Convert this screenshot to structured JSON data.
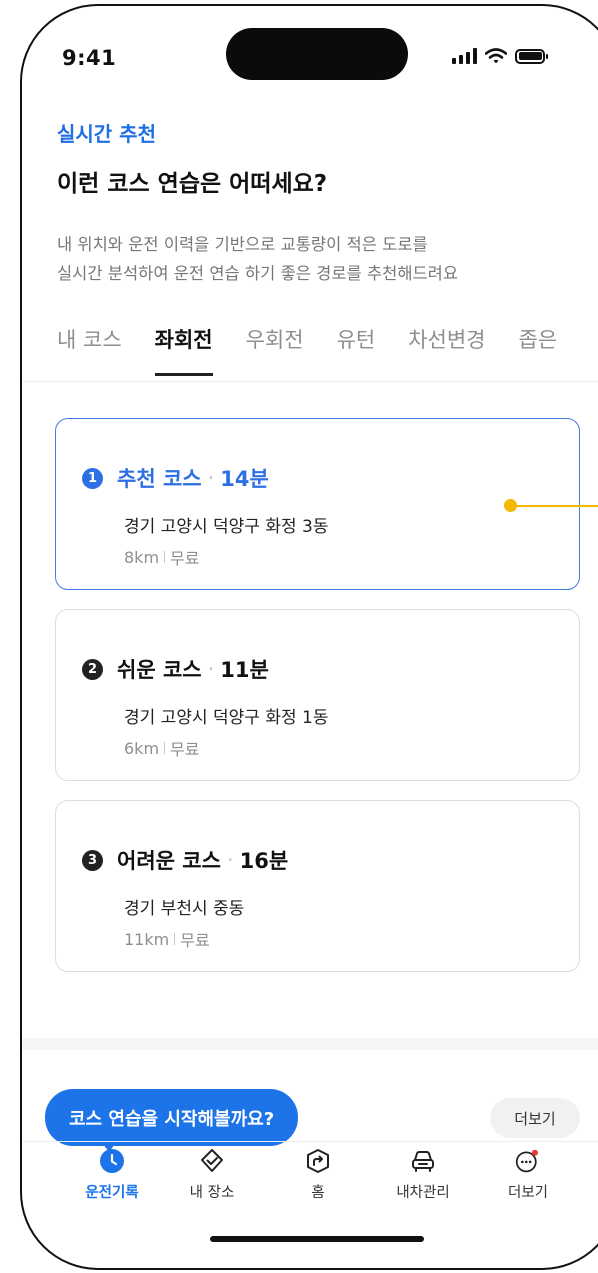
{
  "status_bar": {
    "time": "9:41"
  },
  "header": {
    "eyebrow": "실시간 추천",
    "title": "이런 코스 연습은 어떠세요?",
    "description_lines": [
      "내 위치와 운전 이력을 기반으로 교통량이 적은 도로를",
      "실시간 분석하여 운전 연습 하기 좋은 경로를 추천해드려요"
    ]
  },
  "tabs": [
    {
      "label": "내 코스",
      "active": false
    },
    {
      "label": "좌회전",
      "active": true
    },
    {
      "label": "우회전",
      "active": false
    },
    {
      "label": "유턴",
      "active": false
    },
    {
      "label": "차선변경",
      "active": false
    },
    {
      "label": "좁은",
      "active": false
    }
  ],
  "courses": [
    {
      "number": "1",
      "name": "추천 코스",
      "duration": "14분",
      "address": "경기 고양시 덕양구 화정 3동",
      "distance": "8km",
      "toll": "무료",
      "selected": true
    },
    {
      "number": "2",
      "name": "쉬운 코스",
      "duration": "11분",
      "address": "경기 고양시 덕양구 화정 1동",
      "distance": "6km",
      "toll": "무료",
      "selected": false
    },
    {
      "number": "3",
      "name": "어려운 코스",
      "duration": "16분",
      "address": "경기 부천시 중동",
      "distance": "11km",
      "toll": "무료",
      "selected": false
    }
  ],
  "bubble": {
    "text": "코스 연습을 시작해볼까요?"
  },
  "more_chip": {
    "label": "더보기"
  },
  "bottom_nav": [
    {
      "label": "운전기록",
      "icon": "clock-icon",
      "active": true
    },
    {
      "label": "내 장소",
      "icon": "check-shield-icon",
      "active": false
    },
    {
      "label": "홈",
      "icon": "turn-arrow-icon",
      "active": false
    },
    {
      "label": "내차관리",
      "icon": "car-icon",
      "active": false
    },
    {
      "label": "더보기",
      "icon": "more-icon",
      "active": false
    }
  ],
  "colors": {
    "accent": "#1d73e8",
    "highlight": "#f5b800",
    "notification": "#e53935"
  }
}
